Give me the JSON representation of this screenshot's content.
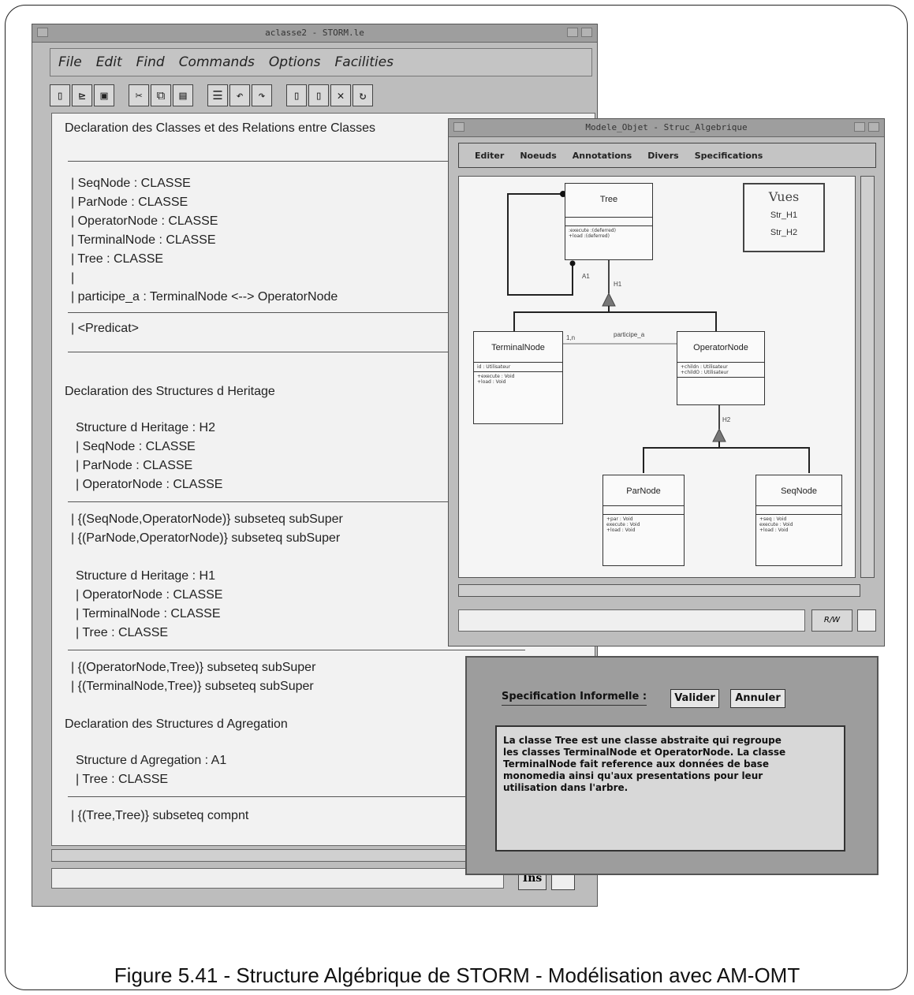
{
  "main_window": {
    "title": "aclasse2 - STORM.le",
    "menu": [
      "File",
      "Edit",
      "Find",
      "Commands",
      "Options",
      "Facilities"
    ],
    "toolbar_icons": [
      "new-file-icon",
      "open-folder-icon",
      "save-icon",
      "cut-icon",
      "copy-icon",
      "paste-icon",
      "format-icon",
      "undo-icon",
      "redo-icon",
      "page-icon",
      "page2-icon",
      "close-x-icon",
      "refresh-icon"
    ],
    "content": {
      "heading_classes": "Declaration des Classes et des Relations entre Classes",
      "classes": [
        "| SeqNode : CLASSE",
        "| ParNode : CLASSE",
        "| OperatorNode : CLASSE",
        "| TerminalNode : CLASSE",
        "| Tree : CLASSE",
        "|",
        "| participe_a : TerminalNode <--> OperatorNode"
      ],
      "predicat": "| <Predicat>",
      "heading_heritage": "Declaration des Structures d Heritage",
      "h2_title": "Structure d Heritage : H2",
      "h2_items": [
        "| SeqNode : CLASSE",
        "| ParNode : CLASSE",
        "| OperatorNode : CLASSE"
      ],
      "h2_rel": [
        "| {(SeqNode,OperatorNode)} subseteq subSuper",
        "| {(ParNode,OperatorNode)} subseteq subSuper"
      ],
      "h1_title": "Structure d Heritage : H1",
      "h1_items": [
        "| OperatorNode : CLASSE",
        "| TerminalNode : CLASSE",
        "| Tree : CLASSE"
      ],
      "h1_rel": [
        "| {(OperatorNode,Tree)} subseteq subSuper",
        "| {(TerminalNode,Tree)} subseteq subSuper"
      ],
      "heading_agregation": "Declaration des Structures d Agregation",
      "a1_title": "Structure d Agregation : A1",
      "a1_items": [
        "| Tree : CLASSE"
      ],
      "a1_rel": [
        "| {(Tree,Tree)} subseteq compnt"
      ]
    },
    "ins_label": "Ins"
  },
  "diagram_window": {
    "title": "Modele_Objet - Struc_Algebrique",
    "menu": [
      "Editer",
      "Noeuds",
      "Annotations",
      "Divers",
      "Specifications"
    ],
    "views_title": "Vues",
    "views": [
      "Str_H1",
      "Str_H2"
    ],
    "classes": {
      "tree": {
        "name": "Tree",
        "ops": [
          ":execute :(deferred)",
          "+load :(deferred)"
        ]
      },
      "terminal": {
        "name": "TerminalNode",
        "attrs": [
          "id : Utilisateur"
        ],
        "ops": [
          "+execute : Void",
          "+load : Void"
        ]
      },
      "operator": {
        "name": "OperatorNode",
        "attrs": [
          "+childn : Utilisateur",
          "+childO : Utilisateur"
        ]
      },
      "par": {
        "name": "ParNode",
        "ops": [
          "+par : Void",
          "execute : Void",
          "+load : Void"
        ]
      },
      "seq": {
        "name": "SeqNode",
        "ops": [
          "+seq : Void",
          "execute : Void",
          "+load : Void"
        ]
      }
    },
    "labels": {
      "a1": "A1",
      "h1": "H1",
      "h2": "H2",
      "participe": "participe_a",
      "mult": "1,n"
    },
    "rw_label": "R/W"
  },
  "spec_dialog": {
    "label": "Specification Informelle :",
    "validate": "Valider",
    "cancel": "Annuler",
    "text": "La classe Tree est une classe abstraite qui regroupe\nles classes TerminalNode et OperatorNode. La classe\nTerminalNode fait reference aux données de base\nmonomedia ainsi qu'aux presentations pour leur\nutilisation dans l'arbre."
  },
  "caption": "Figure 5.41 - Structure Algébrique de STORM - Modélisation avec AM-OMT"
}
